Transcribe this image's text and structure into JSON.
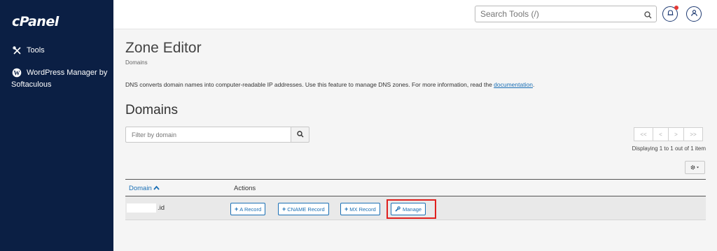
{
  "sidebar": {
    "logo": "cPanel",
    "items": [
      {
        "label": "Tools"
      },
      {
        "label": "WordPress Manager by Softaculous"
      }
    ]
  },
  "topbar": {
    "search_placeholder": "Search Tools (/)"
  },
  "page": {
    "title": "Zone Editor",
    "breadcrumb": "Domains",
    "description": "DNS converts domain names into computer-readable IP addresses. Use this feature to manage DNS zones. For more information, read the",
    "doc_link": "documentation",
    "description_end": "."
  },
  "domains": {
    "title": "Domains",
    "filter_placeholder": "Filter by domain",
    "pager": {
      "first": "<<",
      "prev": "<",
      "next": ">",
      "last": ">>"
    },
    "displaying": "Displaying 1 to 1 out of 1 item",
    "columns": {
      "domain": "Domain",
      "actions": "Actions"
    },
    "rows": [
      {
        "domain_suffix": ".id",
        "actions": {
          "a_record": "A Record",
          "cname_record": "CNAME Record",
          "mx_record": "MX Record",
          "manage": "Manage"
        }
      }
    ]
  },
  "colors": {
    "sidebar_bg": "#0b1f44",
    "link": "#1a6fb5",
    "highlight": "#e0201e"
  }
}
